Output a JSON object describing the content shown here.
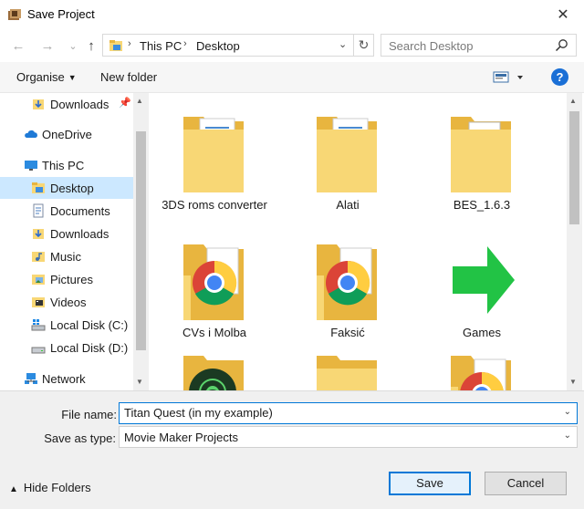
{
  "window": {
    "title": "Save Project",
    "close_glyph": "✕"
  },
  "nav": {
    "back_glyph": "←",
    "forward_glyph": "→",
    "recent_glyph": "⌄",
    "up_glyph": "↑",
    "breadcrumb": [
      "This PC",
      "Desktop"
    ],
    "breadcrumb_separator": "›",
    "address_dropdown_glyph": "⌄",
    "refresh_glyph": "↻",
    "search_placeholder": "Search Desktop"
  },
  "toolbar": {
    "organise": "Organise",
    "new_folder": "New folder",
    "caret": "▼",
    "help": "?"
  },
  "sidebar": {
    "items": [
      {
        "label": "Downloads",
        "icon": "downloads-icon",
        "pinned": true,
        "selected": false
      },
      {
        "label": "OneDrive",
        "icon": "onedrive-icon",
        "selected": false
      },
      {
        "label": "This PC",
        "icon": "this-pc-icon",
        "selected": false
      },
      {
        "label": "Desktop",
        "icon": "desktop-folder-icon",
        "selected": true
      },
      {
        "label": "Documents",
        "icon": "documents-icon",
        "selected": false
      },
      {
        "label": "Downloads",
        "icon": "downloads-icon",
        "selected": false
      },
      {
        "label": "Music",
        "icon": "music-icon",
        "selected": false
      },
      {
        "label": "Pictures",
        "icon": "pictures-icon",
        "selected": false
      },
      {
        "label": "Videos",
        "icon": "videos-icon",
        "selected": false
      },
      {
        "label": "Local Disk (C:)",
        "icon": "windows-drive-icon",
        "selected": false
      },
      {
        "label": "Local Disk (D:)",
        "icon": "drive-icon",
        "selected": false
      },
      {
        "label": "Network",
        "icon": "network-icon",
        "selected": false
      }
    ],
    "pin_glyph": "📌"
  },
  "files": [
    {
      "name": "3DS roms converter",
      "type": "folder-docs"
    },
    {
      "name": "Alati",
      "type": "folder-docs"
    },
    {
      "name": "BES_1.6.3",
      "type": "folder-file"
    },
    {
      "name": "CVs i Molba",
      "type": "folder-chrome"
    },
    {
      "name": "Faksić",
      "type": "folder-chrome"
    },
    {
      "name": "Games",
      "type": "green-arrow"
    },
    {
      "name": "",
      "type": "folder-fingerprint"
    },
    {
      "name": "",
      "type": "folder-plain"
    },
    {
      "name": "",
      "type": "folder-chrome"
    }
  ],
  "footer": {
    "file_name_label": "File name:",
    "file_name_value": "Titan Quest (in my example)",
    "save_as_type_label": "Save as type:",
    "save_as_type_value": "Movie Maker Projects",
    "hide_folders": "Hide Folders",
    "hide_folders_caret": "▲",
    "dropdown_caret": "⌄",
    "save": "Save",
    "cancel": "Cancel"
  },
  "colors": {
    "folder": "#f8d775",
    "folder_dark": "#e8b53f",
    "selected_bg": "#cce8ff",
    "accent": "#0078d7",
    "arrow_green": "#22c345"
  }
}
